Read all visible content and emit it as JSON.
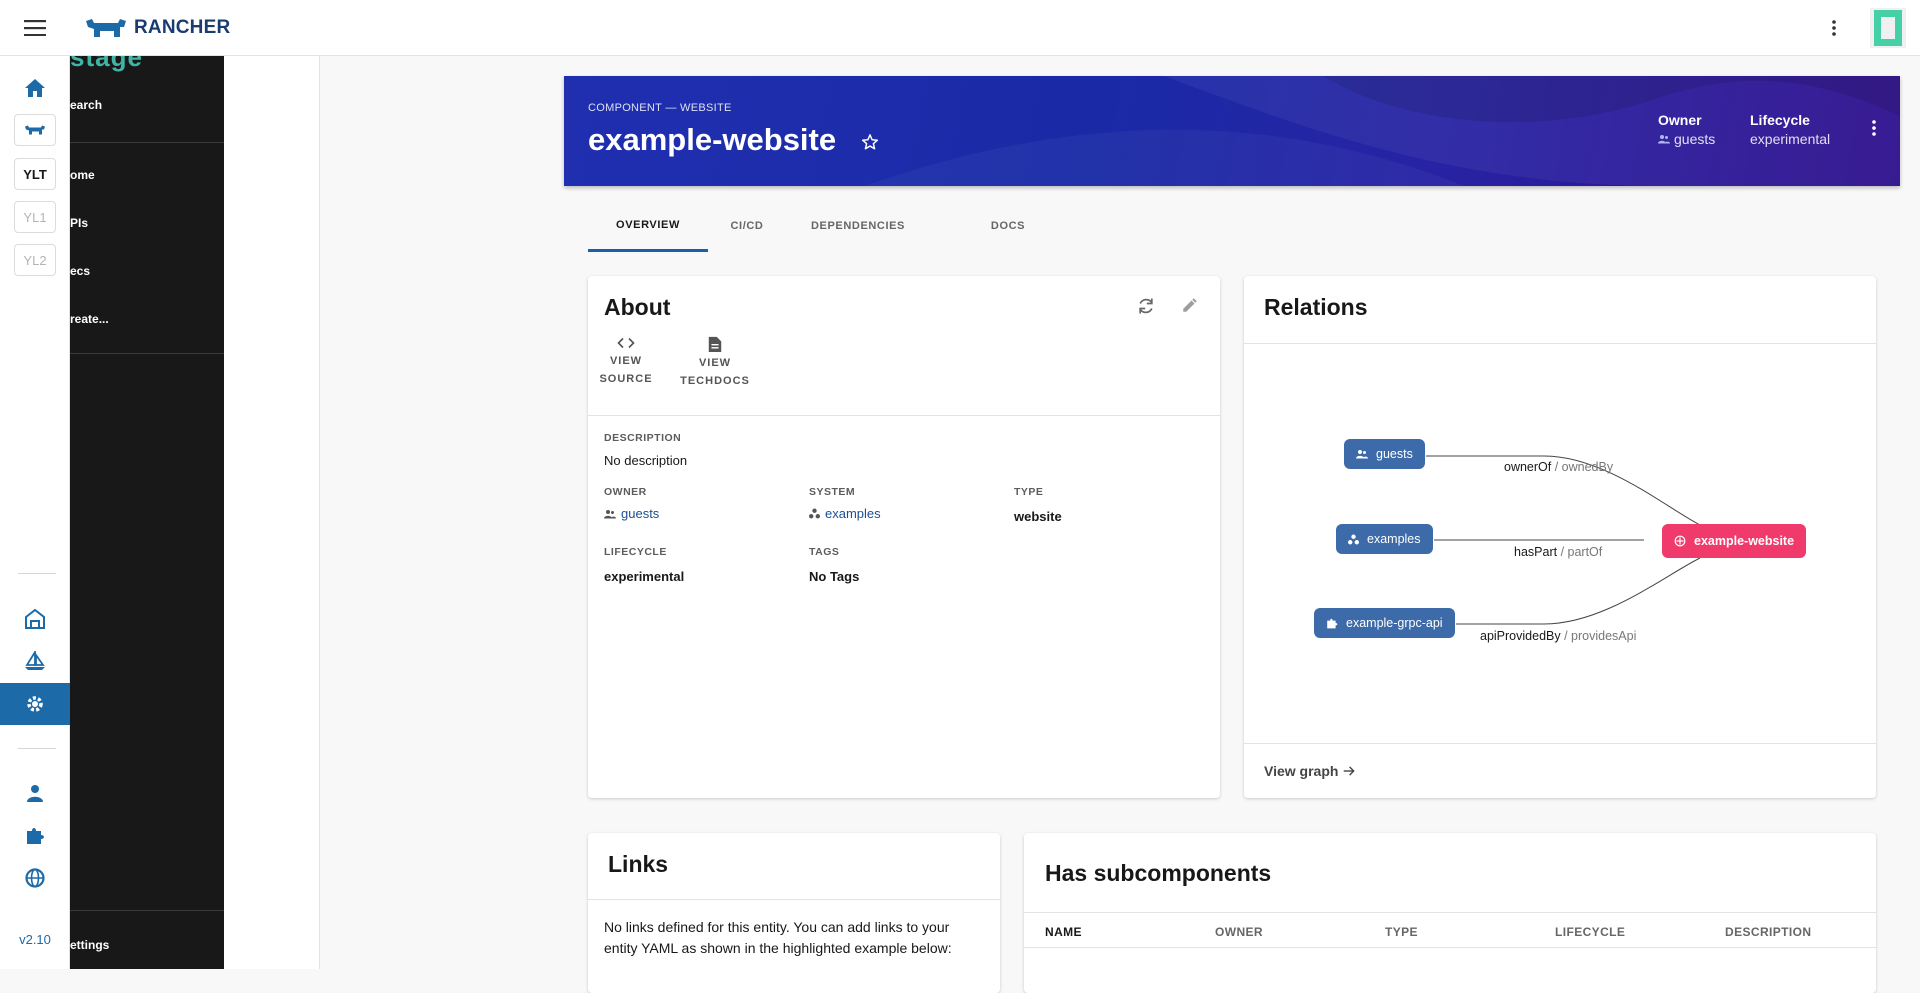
{
  "topbar": {
    "brand": "RANCHER",
    "menu_icon": "hamburger-icon",
    "more_icon": "kebab-icon"
  },
  "rail": {
    "chips": [
      "YLT",
      "YL1",
      "YL2"
    ],
    "version": "v2.10"
  },
  "sidenav": {
    "items": [
      "earch",
      "ome",
      "PIs",
      "ecs",
      "reate...",
      "ettings"
    ]
  },
  "header": {
    "eyebrow": "COMPONENT — WEBSITE",
    "title": "example-website",
    "owner_label": "Owner",
    "owner_value": "guests",
    "lifecycle_label": "Lifecycle",
    "lifecycle_value": "experimental"
  },
  "tabs": [
    "OVERVIEW",
    "CI/CD",
    "DEPENDENCIES",
    "DOCS"
  ],
  "about": {
    "title": "About",
    "links": [
      {
        "line1": "VIEW",
        "line2": "SOURCE",
        "icon": "code-icon"
      },
      {
        "line1": "VIEW",
        "line2": "TECHDOCS",
        "icon": "document-icon"
      }
    ],
    "description_label": "DESCRIPTION",
    "description_value": "No description",
    "owner_label": "OWNER",
    "owner_value": "guests",
    "system_label": "SYSTEM",
    "system_value": "examples",
    "type_label": "TYPE",
    "type_value": "website",
    "lifecycle_label": "LIFECYCLE",
    "lifecycle_value": "experimental",
    "tags_label": "TAGS",
    "tags_value": "No Tags"
  },
  "relations": {
    "title": "Relations",
    "nodes": {
      "guests": "guests",
      "examples": "examples",
      "api": "example-grpc-api",
      "target": "example-website"
    },
    "edges": [
      {
        "label": "ownerOf",
        "alt": " / ownedBy"
      },
      {
        "label": "hasPart",
        "alt": " / partOf"
      },
      {
        "label": "apiProvidedBy",
        "alt": " / providesApi"
      }
    ],
    "view_graph": "View graph"
  },
  "links": {
    "title": "Links",
    "text": "No links defined for this entity. You can add links to your entity YAML as shown in the highlighted example below:"
  },
  "subcomponents": {
    "title": "Has subcomponents",
    "columns": [
      "NAME",
      "OWNER",
      "TYPE",
      "LIFECYCLE",
      "DESCRIPTION"
    ]
  },
  "colors": {
    "primary": "#1c6aa8",
    "accent_pink": "#ef3a6b",
    "node_blue": "#3d6aa8",
    "header_from": "#1f2fb0",
    "header_to": "#2e0f8d"
  }
}
